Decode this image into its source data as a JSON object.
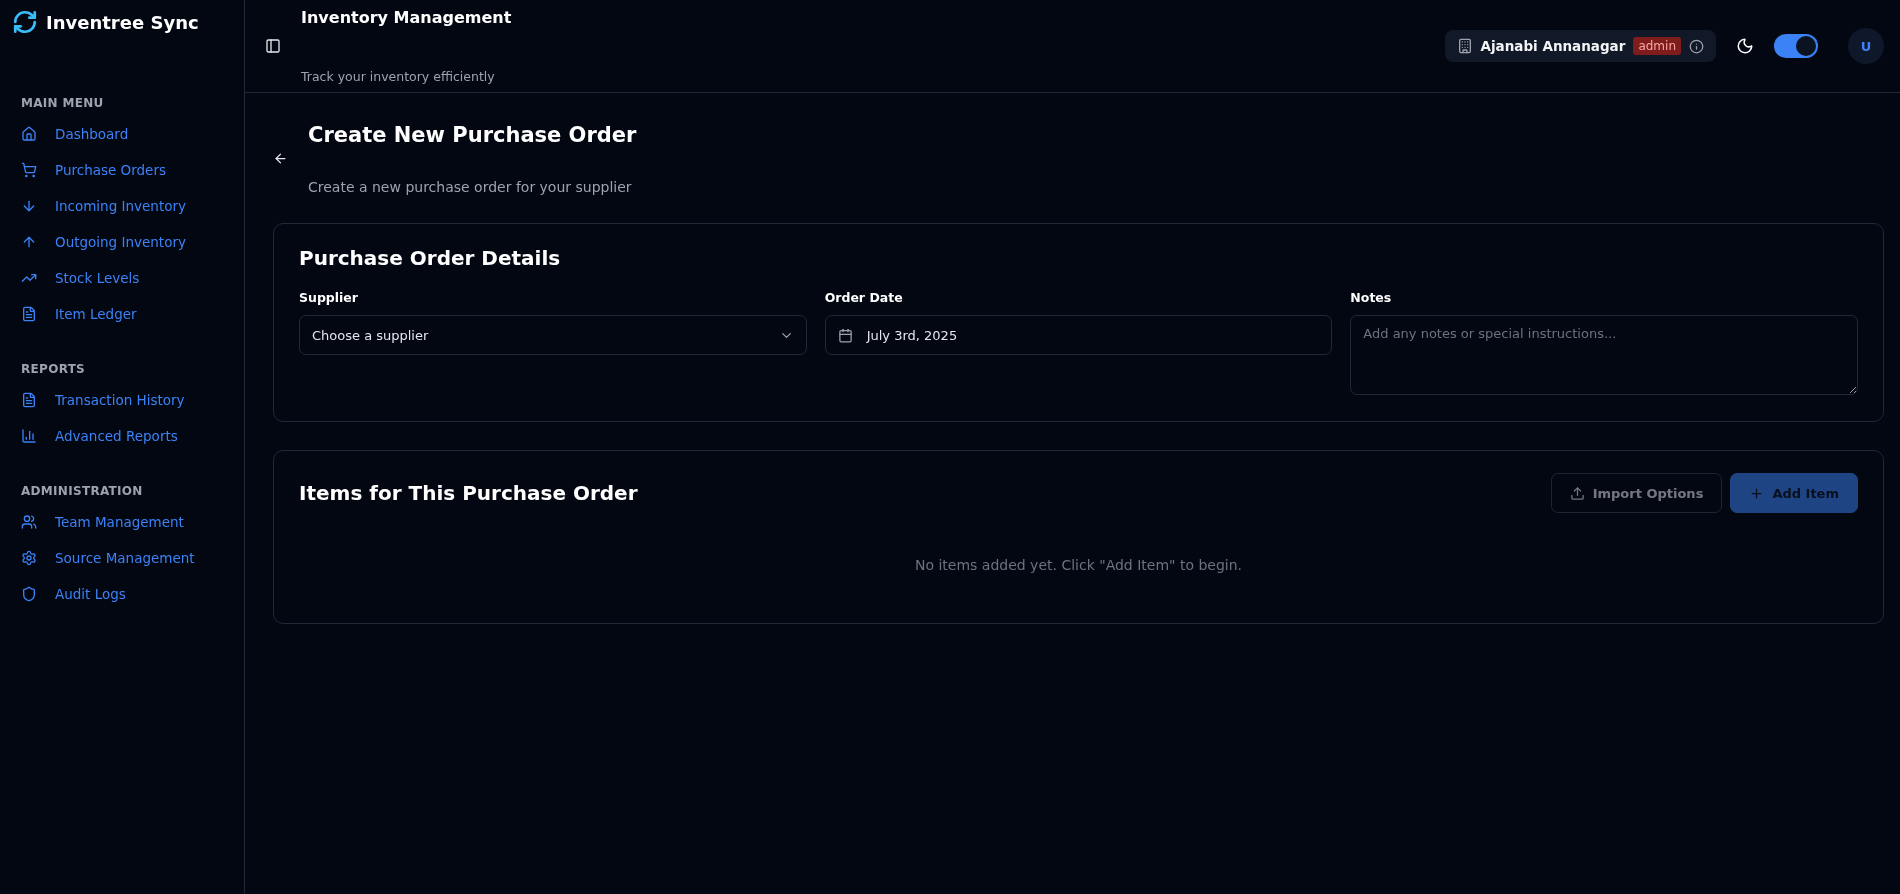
{
  "app": {
    "name": "Inventree Sync"
  },
  "sidebar": {
    "sections": [
      {
        "title": "MAIN MENU",
        "items": [
          {
            "label": "Dashboard"
          },
          {
            "label": "Purchase Orders"
          },
          {
            "label": "Incoming Inventory"
          },
          {
            "label": "Outgoing Inventory"
          },
          {
            "label": "Stock Levels"
          },
          {
            "label": "Item Ledger"
          }
        ]
      },
      {
        "title": "REPORTS",
        "items": [
          {
            "label": "Transaction History"
          },
          {
            "label": "Advanced Reports"
          }
        ]
      },
      {
        "title": "ADMINISTRATION",
        "items": [
          {
            "label": "Team Management"
          },
          {
            "label": "Source Management"
          },
          {
            "label": "Audit Logs"
          }
        ]
      }
    ]
  },
  "header": {
    "title": "Inventory Management",
    "subtitle": "Track your inventory efficiently",
    "location": "Ajanabi Annanagar",
    "role": "admin",
    "dark_mode": {
      "on": true
    },
    "avatar": "U"
  },
  "page": {
    "title": "Create New Purchase Order",
    "subtitle": "Create a new purchase order for your supplier"
  },
  "details": {
    "title": "Purchase Order Details",
    "supplier": {
      "label": "Supplier",
      "value": "Choose a supplier"
    },
    "order_date": {
      "label": "Order Date",
      "value": "July 3rd, 2025"
    },
    "notes": {
      "label": "Notes",
      "placeholder": "Add any notes or special instructions..."
    }
  },
  "items": {
    "title": "Items for This Purchase Order",
    "buttons": [
      {
        "label": "Import Options",
        "kind": "outline",
        "disabled": true
      },
      {
        "label": "Add Item",
        "kind": "primary",
        "disabled": true
      }
    ],
    "empty_message": "No items added yet. Click \"Add Item\" to begin."
  }
}
